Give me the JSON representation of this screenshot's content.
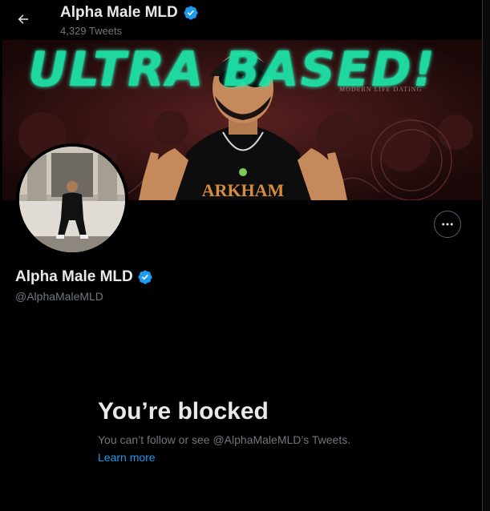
{
  "header": {
    "name": "Alpha Male MLD",
    "tweet_count": "4,329 Tweets"
  },
  "banner": {
    "headline": "ULTRA BASED!",
    "subtitle": "MODERN LIFE DATING",
    "shirt_text": "ARKHAM"
  },
  "profile": {
    "name": "Alpha Male MLD",
    "handle": "@AlphaMaleMLD",
    "verified": true
  },
  "blocked": {
    "title": "You’re blocked",
    "message": "You can’t follow or see @AlphaMaleMLD’s Tweets.",
    "learn_more": "Learn more"
  },
  "colors": {
    "background": "#000000",
    "primary_text": "#e7e9ea",
    "secondary_text": "#71767b",
    "link": "#1d9bf0",
    "verified_badge": "#1d9bf0"
  },
  "icons": {
    "back": "arrow-left-icon",
    "verified": "verified-badge-icon",
    "more": "more-horizontal-icon"
  }
}
